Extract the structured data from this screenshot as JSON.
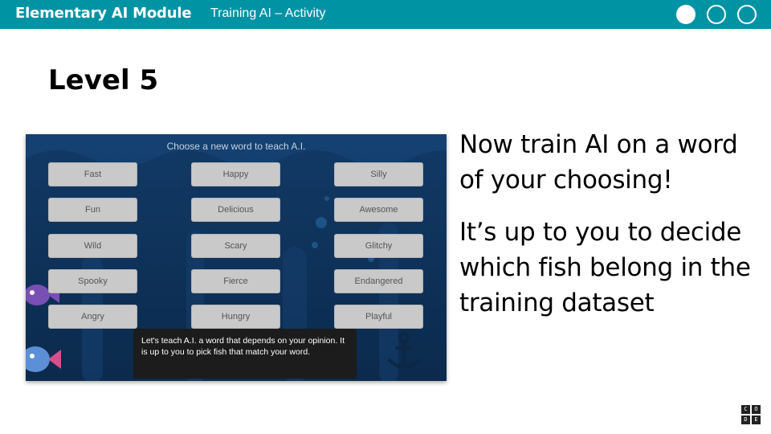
{
  "header": {
    "module_title": "Elementary AI Module",
    "activity": "Training AI – Activity",
    "progress_dots": [
      "filled",
      "empty",
      "empty"
    ]
  },
  "slide": {
    "title": "Level 5",
    "body_line1": "Now train AI on a word of your choosing!",
    "body_line2": "It’s up to you to decide which fish belong in the training dataset"
  },
  "game": {
    "prompt": "Choose a new word to teach A.I.",
    "words": [
      "Fast",
      "Happy",
      "Silly",
      "Fun",
      "Delicious",
      "Awesome",
      "Wild",
      "Scary",
      "Glitchy",
      "Spooky",
      "Fierce",
      "Endangered",
      "Angry",
      "Hungry",
      "Playful"
    ],
    "hint": "Let's teach A.I. a word that depends on your opinion. It is up to you to pick fish that match your word."
  },
  "logo": {
    "letters": [
      "C",
      "O",
      "D",
      "E"
    ]
  },
  "colors": {
    "header_bg": "#0093a4",
    "game_bg": "#0e3158",
    "button_bg": "#c9c9c9"
  }
}
